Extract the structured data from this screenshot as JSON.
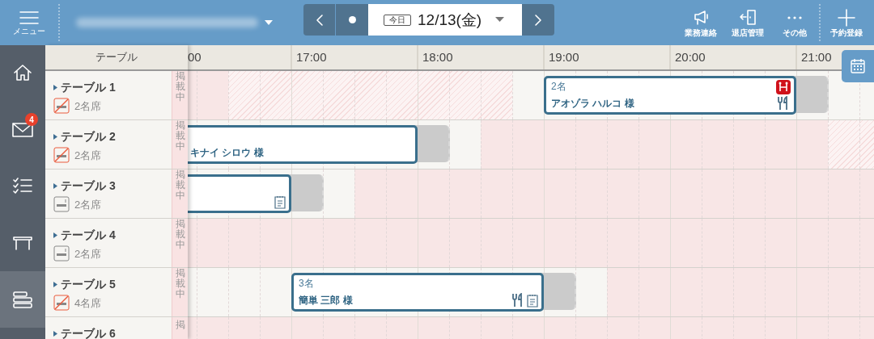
{
  "header": {
    "menu_label": "メニュー",
    "date_nav": {
      "today_tag": "今日",
      "date": "12/13(金)"
    },
    "actions": [
      {
        "kind": "announce",
        "label": "業務連絡"
      },
      {
        "kind": "checkout",
        "label": "退店管理"
      },
      {
        "kind": "more",
        "label": "その他"
      },
      {
        "kind": "add",
        "label": "予約登録"
      }
    ]
  },
  "sidebar": {
    "items": [
      {
        "kind": "home",
        "selected": false
      },
      {
        "kind": "mail",
        "selected": false,
        "badge": "4"
      },
      {
        "kind": "checklist",
        "selected": false
      },
      {
        "kind": "table",
        "selected": false
      },
      {
        "kind": "timeline",
        "selected": true
      }
    ]
  },
  "table_header": "テーブル",
  "hours": [
    "00",
    "17:00",
    "18:00",
    "19:00",
    "20:00",
    "21:00"
  ],
  "rows": [
    {
      "name": "テーブル 1",
      "seats": "2名席",
      "smoking": false,
      "status": "掲載中",
      "reservations": [
        {
          "party": "2名",
          "guest": "アオゾラ ハルコ 様",
          "badge": true,
          "cutlery": true
        }
      ]
    },
    {
      "name": "テーブル 2",
      "seats": "2名席",
      "smoking": false,
      "status": "掲載中",
      "reservations": [
        {
          "guest": "キナイ シロウ 様"
        }
      ]
    },
    {
      "name": "テーブル 3",
      "seats": "2名席",
      "smoking": true,
      "status": "掲載中",
      "reservations": [
        {
          "memo": true
        }
      ]
    },
    {
      "name": "テーブル 4",
      "seats": "2名席",
      "smoking": true,
      "status": "掲載中"
    },
    {
      "name": "テーブル 5",
      "seats": "4名席",
      "smoking": false,
      "status": "掲載中",
      "reservations": [
        {
          "party": "3名",
          "guest": "簡単 三郎 様",
          "cutlery": true,
          "memo": true
        }
      ]
    },
    {
      "name": "テーブル 6",
      "status": "掲"
    }
  ]
}
